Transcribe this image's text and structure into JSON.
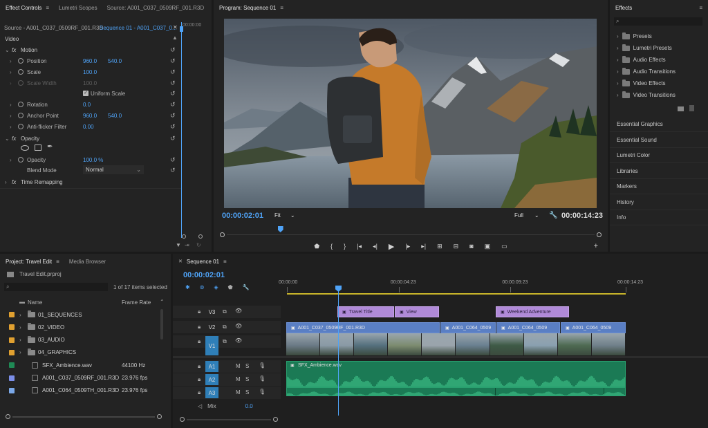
{
  "effect_controls": {
    "tabs": [
      "Effect Controls",
      "Lumetri Scopes",
      "Source: A001_C037_0509RF_001.R3D"
    ],
    "source_label": "Source - A001_C037_0509RF_001.R3D",
    "sequence_label": "Sequence 01 - A001_C037_0...",
    "time_marker": "00:00:00",
    "section_video": "Video",
    "motion": "Motion",
    "position": {
      "label": "Position",
      "x": "960.0",
      "y": "540.0"
    },
    "scale": {
      "label": "Scale",
      "value": "100.0"
    },
    "scale_width": {
      "label": "Scale Width",
      "value": "100.0"
    },
    "uniform_scale": "Uniform Scale",
    "rotation": {
      "label": "Rotation",
      "value": "0.0"
    },
    "anchor": {
      "label": "Anchor Point",
      "x": "960.0",
      "y": "540.0"
    },
    "antiflicker": {
      "label": "Anti-flicker Filter",
      "value": "0.00"
    },
    "opacity_section": "Opacity",
    "opacity": {
      "label": "Opacity",
      "value": "100.0 %"
    },
    "blend": {
      "label": "Blend Mode",
      "value": "Normal"
    },
    "time_remap": "Time Remapping",
    "fx": "fx"
  },
  "program": {
    "title": "Program: Sequence 01",
    "timecode": "00:00:02:01",
    "fit": "Fit",
    "quality": "Full",
    "duration": "00:00:14:23",
    "playhead": 0.14
  },
  "effects": {
    "title": "Effects",
    "folders": [
      "Presets",
      "Lumetri Presets",
      "Audio Effects",
      "Audio Transitions",
      "Video Effects",
      "Video Transitions"
    ],
    "panels": [
      "Essential Graphics",
      "Essential Sound",
      "Lumetri Color",
      "Libraries",
      "Markers",
      "History",
      "Info"
    ]
  },
  "project": {
    "tabs": [
      "Project: Travel Edit",
      "Media Browser"
    ],
    "file": "Travel Edit.prproj",
    "count": "1 of 17 items selected",
    "col_name": "Name",
    "col_rate": "Frame Rate",
    "items": [
      {
        "name": "01_SEQUENCES",
        "rate": "",
        "color": "#e0a030",
        "folder": true
      },
      {
        "name": "02_VIDEO",
        "rate": "",
        "color": "#e0a030",
        "folder": true
      },
      {
        "name": "03_AUDIO",
        "rate": "",
        "color": "#e0a030",
        "folder": true
      },
      {
        "name": "04_GRAPHICS",
        "rate": "",
        "color": "#e0a030",
        "folder": true
      },
      {
        "name": "SFX_Ambience.wav",
        "rate": "44100 Hz",
        "color": "#1f8a55",
        "folder": false
      },
      {
        "name": "A001_C037_0509RF_001.R3D",
        "rate": "23.976 fps",
        "color": "#7b8ee8",
        "folder": false
      },
      {
        "name": "A001_C064_0509TH_001.R3D",
        "rate": "23.976 fps",
        "color": "#7ba8e8",
        "folder": false
      }
    ]
  },
  "timeline": {
    "title": "Sequence 01",
    "timecode": "00:00:02:01",
    "ruler": [
      "00:00:00",
      "00:00:04:23",
      "00:00:09:23",
      "00:00:14:23"
    ],
    "tracks": [
      "V3",
      "V2",
      "V1",
      "A1",
      "A2",
      "A3"
    ],
    "mix": "Mix",
    "mix_value": "0.0",
    "m": "M",
    "s": "S",
    "clips": {
      "travel_title": "Travel Title",
      "view": "View",
      "weekend": "Weekend Adventure",
      "v_a": "A001_C037_0509RF_001.R3D",
      "v_b": "A001_C064_0509",
      "v_c": "A001_C064_0509",
      "v_d": "A001_C064_0509",
      "audio": "SFX_Ambience.wav"
    }
  },
  "colors": {
    "accent": "#4fa3f7",
    "video_clip": "#5a7fc4",
    "graphic_clip": "#b08ad8",
    "audio_clip": "#1b7a55"
  }
}
